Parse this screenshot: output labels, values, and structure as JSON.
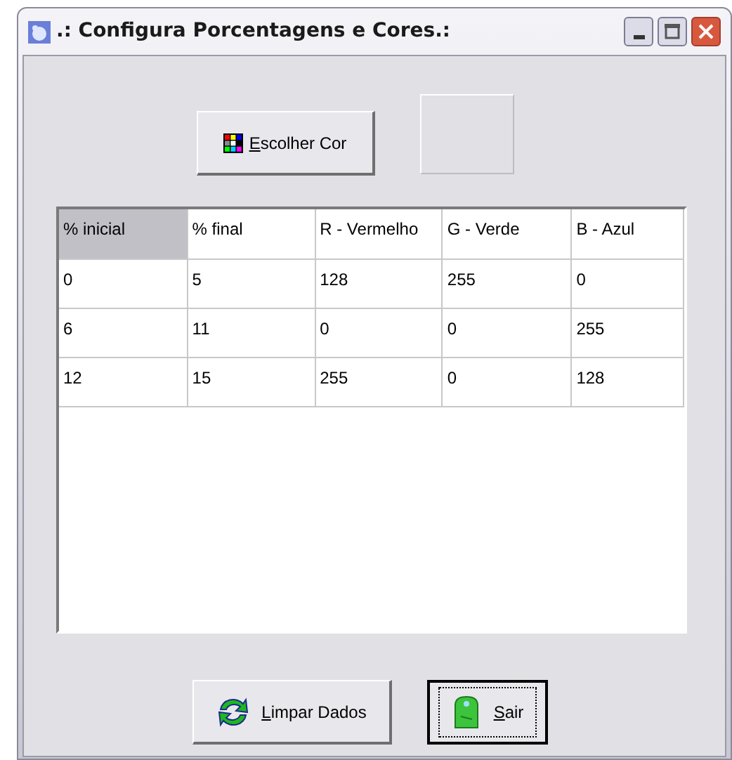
{
  "window": {
    "title": ".: Configura Porcentagens e Cores.:"
  },
  "color_button": {
    "label": "Escolher Cor"
  },
  "table": {
    "columns": [
      {
        "label": "% inicial",
        "selected": true
      },
      {
        "label": "% final",
        "selected": false
      },
      {
        "label": "R - Vermelho",
        "selected": false
      },
      {
        "label": "G - Verde",
        "selected": false
      },
      {
        "label": "B - Azul",
        "selected": false
      }
    ],
    "rows": [
      [
        "0",
        "5",
        "128",
        "255",
        "0"
      ],
      [
        "6",
        "11",
        "0",
        "0",
        "255"
      ],
      [
        "12",
        "15",
        "255",
        "0",
        "128"
      ]
    ]
  },
  "buttons": [
    {
      "kind": "clear",
      "label": "Limpar Dados",
      "focused": false
    },
    {
      "kind": "exit",
      "label": "Sair",
      "focused": true
    }
  ]
}
